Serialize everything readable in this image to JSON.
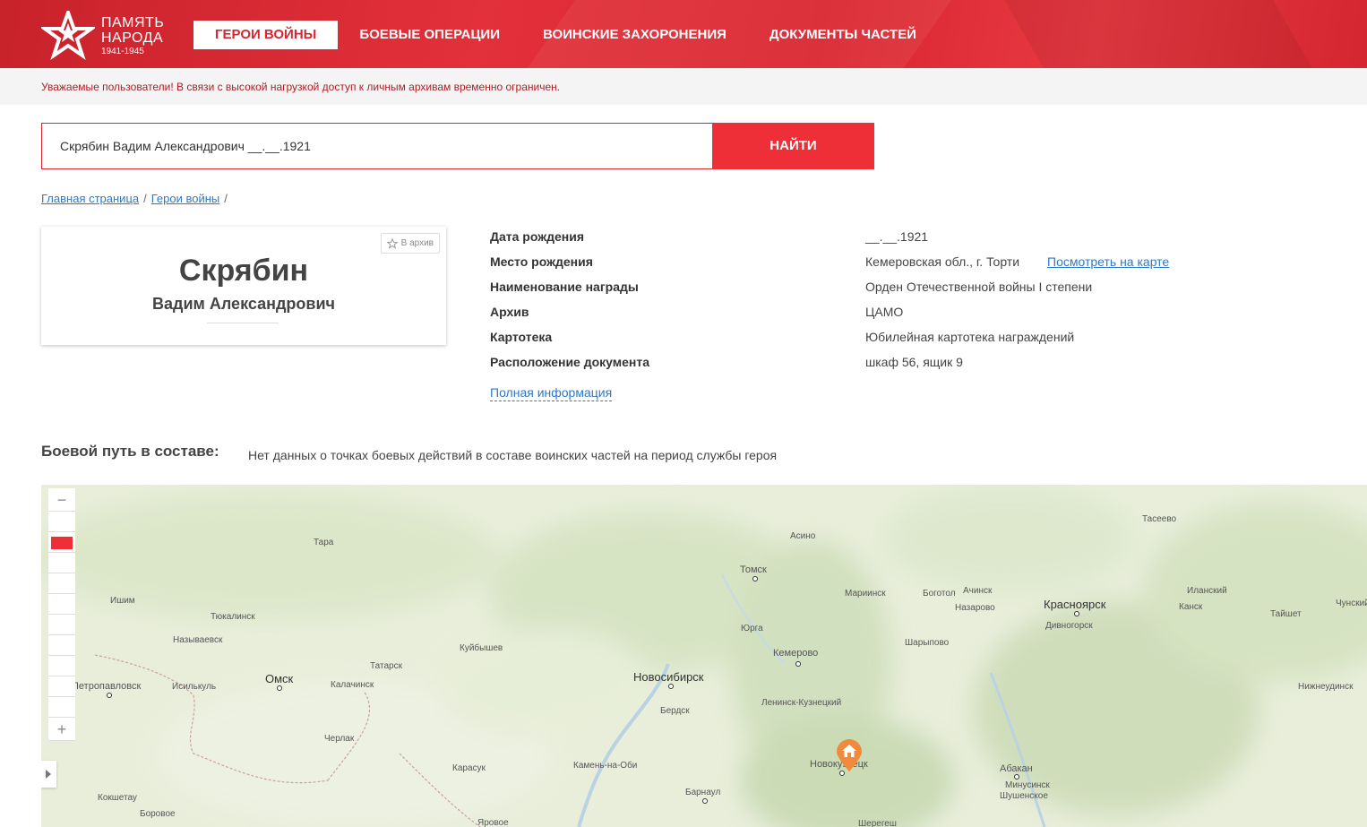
{
  "header": {
    "logo_line1": "ПАМЯТЬ",
    "logo_line2": "НАРОДА",
    "logo_years": "1941-1945",
    "nav": [
      {
        "label": "Герои войны",
        "active": true
      },
      {
        "label": "Боевые операции",
        "active": false
      },
      {
        "label": "Воинские захоронения",
        "active": false
      },
      {
        "label": "Документы частей",
        "active": false
      }
    ],
    "brand_color": "#d9252f"
  },
  "notice": "Уважаемые пользователи! В связи с высокой нагрузкой доступ к личным архивам временно ограничен.",
  "search": {
    "value": "Скрябин Вадим Александрович __.__.1921",
    "button_label": "НАЙТИ"
  },
  "breadcrumb": {
    "items": [
      "Главная страница",
      "Герои войны"
    ],
    "separator": "/"
  },
  "hero": {
    "surname": "Скрябин",
    "given_names": "Вадим Александрович",
    "archive_button": "В архив"
  },
  "info": {
    "rows": [
      {
        "label": "Дата рождения",
        "value": "__.__.1921"
      },
      {
        "label": "Место рождения",
        "value": "Кемеровская обл., г. Торти"
      },
      {
        "label": "Наименование награды",
        "value": "Орден Отечественной войны I степени"
      },
      {
        "label": "Архив",
        "value": "ЦАМО"
      },
      {
        "label": "Картотека",
        "value": "Юбилейная картотека награждений"
      },
      {
        "label": "Расположение документа",
        "value": "шкаф 56, ящик 9"
      }
    ],
    "map_link": "Посмотреть на карте",
    "full_info": "Полная информация"
  },
  "combat_path": {
    "title": "Боевой путь в составе:",
    "text": "Нет данных о точках боевых действий в составе воинских частей на период службы героя"
  },
  "map": {
    "zoom_in": "+",
    "zoom_out": "−",
    "marker_icon": "home-icon",
    "marker_color": "#f08a3c",
    "cities": [
      "Тасеево",
      "Асино",
      "Тара",
      "Томск",
      "Мариинск",
      "Боготол",
      "Ачинск",
      "Назарово",
      "Красноярск",
      "Дивногорск",
      "Иланский",
      "Канск",
      "Тайшет",
      "Чунский",
      "Ишим",
      "Тюкалинск",
      "Называевск",
      "Куйбышев",
      "Юрга",
      "Шарыпово",
      "Кемерово",
      "Омск",
      "Татарск",
      "Новосибирск",
      "Петропавловск",
      "Исилькуль",
      "Калачинск",
      "Бердск",
      "Ленинск-Кузнецкий",
      "Нижнеудинск",
      "Черлак",
      "Карасук",
      "Камень-на-Оби",
      "Новокузнецк",
      "Абакан",
      "Минусинск",
      "Шушенское",
      "Кокшетау",
      "Боровое",
      "Барнаул",
      "Яровое",
      "Шерегеш"
    ]
  }
}
